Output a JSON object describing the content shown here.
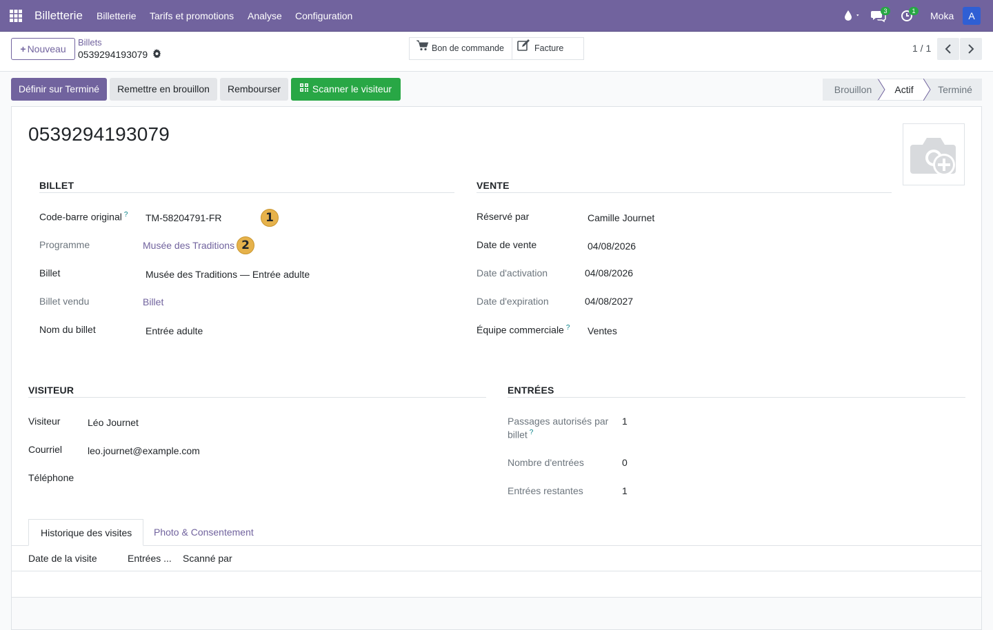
{
  "navbar": {
    "brand": "Billetterie",
    "menu": [
      "Billetterie",
      "Tarifs et promotions",
      "Analyse",
      "Configuration"
    ],
    "messages_count": "3",
    "activities_count": "1",
    "user_name": "Moka",
    "avatar_letter": "A"
  },
  "control_panel": {
    "new_button": "Nouveau",
    "breadcrumb_parent": "Billets",
    "breadcrumb_current": "0539294193079",
    "smart_buttons": [
      "Bon de commande",
      "Facture"
    ],
    "pager": "1 / 1"
  },
  "statusbar": {
    "buttons": [
      "Définir sur Terminé",
      "Remettre en brouillon",
      "Rembourser",
      "Scanner le visiteur"
    ],
    "stages": [
      "Brouillon",
      "Actif",
      "Terminé"
    ],
    "active_stage": "Actif"
  },
  "record": {
    "title": "0539294193079",
    "billet": {
      "section": "BILLET",
      "code_label": "Code-barre original",
      "code_value": "TM-58204791-FR",
      "programme_label": "Programme",
      "programme_value": "Musée des Traditions",
      "billet_label": "Billet",
      "billet_value": "Musée des Traditions — Entrée adulte",
      "billet_vendu_label": "Billet vendu",
      "billet_vendu_value": "Billet",
      "nom_label": "Nom du billet",
      "nom_value": "Entrée adulte"
    },
    "vente": {
      "section": "VENTE",
      "reserve_label": "Réservé par",
      "reserve_value": "Camille Journet",
      "date_vente_label": "Date de vente",
      "date_vente_value": "04/08/2026",
      "date_activation_label": "Date d'activation",
      "date_activation_value": "04/08/2026",
      "date_expiration_label": "Date d'expiration",
      "date_expiration_value": "04/08/2027",
      "equipe_label": "Équipe commerciale",
      "equipe_value": "Ventes"
    },
    "visiteur": {
      "section": "VISITEUR",
      "visiteur_label": "Visiteur",
      "visiteur_value": "Léo Journet",
      "courriel_label": "Courriel",
      "courriel_value": "leo.journet@example.com",
      "telephone_label": "Téléphone",
      "telephone_value": ""
    },
    "entrees": {
      "section": "ENTRÉES",
      "passages_label_1": "Passages autorisés par",
      "passages_label_2": "billet",
      "passages_value": "1",
      "nombre_label": "Nombre d'entrées",
      "nombre_value": "0",
      "restantes_label": "Entrées restantes",
      "restantes_value": "1"
    }
  },
  "tabs": {
    "items": [
      "Historique des visites",
      "Photo & Consentement"
    ],
    "columns": [
      "Date de la visite",
      "Entrées ...",
      "Scanné par"
    ]
  },
  "annotations": [
    "1",
    "2"
  ],
  "help_mark": "?",
  "colors": {
    "brand": "#71639e",
    "success": "#28a745",
    "annotation": "#e6b24b"
  }
}
